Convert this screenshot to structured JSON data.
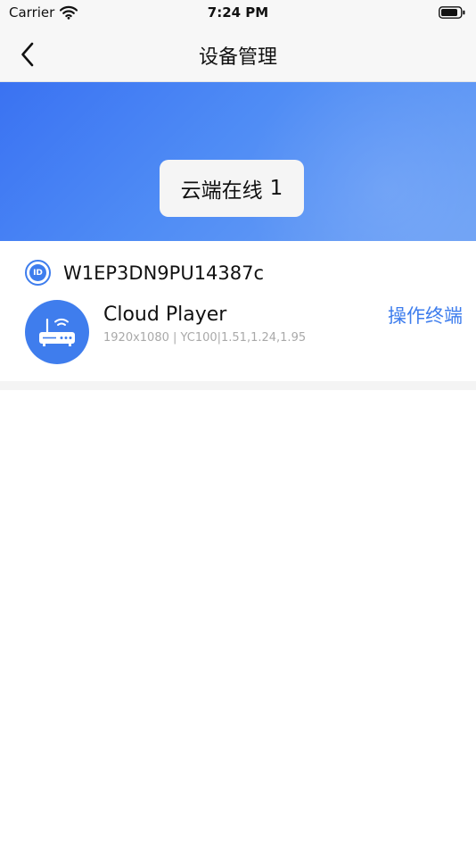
{
  "status_bar": {
    "carrier": "Carrier",
    "time": "7:24 PM",
    "wifi_icon": "wifi-icon",
    "battery_icon": "battery-icon"
  },
  "nav": {
    "title": "设备管理",
    "back_icon": "chevron-left-icon"
  },
  "banner": {
    "online_label": "云端在线",
    "online_count": "1",
    "gradient_start": "#3a72f2",
    "gradient_end": "#6ea2f5"
  },
  "device": {
    "id_icon_label": "ID",
    "id": "W1EP3DN9PU14387c",
    "name": "Cloud Player",
    "spec": "1920x1080 | YC100|1.51,1.24,1.95",
    "action_label": "操作终端",
    "avatar_icon": "router-icon"
  },
  "colors": {
    "accent": "#3e7ded",
    "nav_background": "#f7f7f7",
    "secondary_text": "#a9a9a9"
  }
}
